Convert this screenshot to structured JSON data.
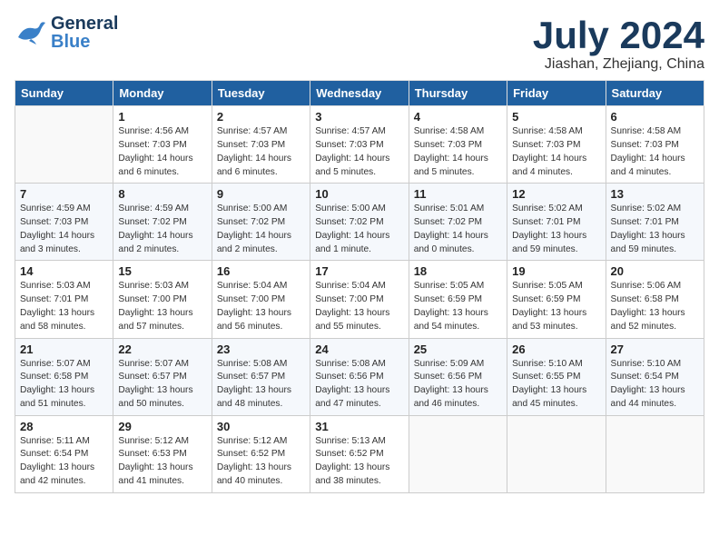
{
  "header": {
    "logo_general": "General",
    "logo_blue": "Blue",
    "month_title": "July 2024",
    "location": "Jiashan, Zhejiang, China"
  },
  "columns": [
    "Sunday",
    "Monday",
    "Tuesday",
    "Wednesday",
    "Thursday",
    "Friday",
    "Saturday"
  ],
  "weeks": [
    [
      {
        "day": "",
        "info": ""
      },
      {
        "day": "1",
        "info": "Sunrise: 4:56 AM\nSunset: 7:03 PM\nDaylight: 14 hours\nand 6 minutes."
      },
      {
        "day": "2",
        "info": "Sunrise: 4:57 AM\nSunset: 7:03 PM\nDaylight: 14 hours\nand 6 minutes."
      },
      {
        "day": "3",
        "info": "Sunrise: 4:57 AM\nSunset: 7:03 PM\nDaylight: 14 hours\nand 5 minutes."
      },
      {
        "day": "4",
        "info": "Sunrise: 4:58 AM\nSunset: 7:03 PM\nDaylight: 14 hours\nand 5 minutes."
      },
      {
        "day": "5",
        "info": "Sunrise: 4:58 AM\nSunset: 7:03 PM\nDaylight: 14 hours\nand 4 minutes."
      },
      {
        "day": "6",
        "info": "Sunrise: 4:58 AM\nSunset: 7:03 PM\nDaylight: 14 hours\nand 4 minutes."
      }
    ],
    [
      {
        "day": "7",
        "info": "Sunrise: 4:59 AM\nSunset: 7:03 PM\nDaylight: 14 hours\nand 3 minutes."
      },
      {
        "day": "8",
        "info": "Sunrise: 4:59 AM\nSunset: 7:02 PM\nDaylight: 14 hours\nand 2 minutes."
      },
      {
        "day": "9",
        "info": "Sunrise: 5:00 AM\nSunset: 7:02 PM\nDaylight: 14 hours\nand 2 minutes."
      },
      {
        "day": "10",
        "info": "Sunrise: 5:00 AM\nSunset: 7:02 PM\nDaylight: 14 hours\nand 1 minute."
      },
      {
        "day": "11",
        "info": "Sunrise: 5:01 AM\nSunset: 7:02 PM\nDaylight: 14 hours\nand 0 minutes."
      },
      {
        "day": "12",
        "info": "Sunrise: 5:02 AM\nSunset: 7:01 PM\nDaylight: 13 hours\nand 59 minutes."
      },
      {
        "day": "13",
        "info": "Sunrise: 5:02 AM\nSunset: 7:01 PM\nDaylight: 13 hours\nand 59 minutes."
      }
    ],
    [
      {
        "day": "14",
        "info": "Sunrise: 5:03 AM\nSunset: 7:01 PM\nDaylight: 13 hours\nand 58 minutes."
      },
      {
        "day": "15",
        "info": "Sunrise: 5:03 AM\nSunset: 7:00 PM\nDaylight: 13 hours\nand 57 minutes."
      },
      {
        "day": "16",
        "info": "Sunrise: 5:04 AM\nSunset: 7:00 PM\nDaylight: 13 hours\nand 56 minutes."
      },
      {
        "day": "17",
        "info": "Sunrise: 5:04 AM\nSunset: 7:00 PM\nDaylight: 13 hours\nand 55 minutes."
      },
      {
        "day": "18",
        "info": "Sunrise: 5:05 AM\nSunset: 6:59 PM\nDaylight: 13 hours\nand 54 minutes."
      },
      {
        "day": "19",
        "info": "Sunrise: 5:05 AM\nSunset: 6:59 PM\nDaylight: 13 hours\nand 53 minutes."
      },
      {
        "day": "20",
        "info": "Sunrise: 5:06 AM\nSunset: 6:58 PM\nDaylight: 13 hours\nand 52 minutes."
      }
    ],
    [
      {
        "day": "21",
        "info": "Sunrise: 5:07 AM\nSunset: 6:58 PM\nDaylight: 13 hours\nand 51 minutes."
      },
      {
        "day": "22",
        "info": "Sunrise: 5:07 AM\nSunset: 6:57 PM\nDaylight: 13 hours\nand 50 minutes."
      },
      {
        "day": "23",
        "info": "Sunrise: 5:08 AM\nSunset: 6:57 PM\nDaylight: 13 hours\nand 48 minutes."
      },
      {
        "day": "24",
        "info": "Sunrise: 5:08 AM\nSunset: 6:56 PM\nDaylight: 13 hours\nand 47 minutes."
      },
      {
        "day": "25",
        "info": "Sunrise: 5:09 AM\nSunset: 6:56 PM\nDaylight: 13 hours\nand 46 minutes."
      },
      {
        "day": "26",
        "info": "Sunrise: 5:10 AM\nSunset: 6:55 PM\nDaylight: 13 hours\nand 45 minutes."
      },
      {
        "day": "27",
        "info": "Sunrise: 5:10 AM\nSunset: 6:54 PM\nDaylight: 13 hours\nand 44 minutes."
      }
    ],
    [
      {
        "day": "28",
        "info": "Sunrise: 5:11 AM\nSunset: 6:54 PM\nDaylight: 13 hours\nand 42 minutes."
      },
      {
        "day": "29",
        "info": "Sunrise: 5:12 AM\nSunset: 6:53 PM\nDaylight: 13 hours\nand 41 minutes."
      },
      {
        "day": "30",
        "info": "Sunrise: 5:12 AM\nSunset: 6:52 PM\nDaylight: 13 hours\nand 40 minutes."
      },
      {
        "day": "31",
        "info": "Sunrise: 5:13 AM\nSunset: 6:52 PM\nDaylight: 13 hours\nand 38 minutes."
      },
      {
        "day": "",
        "info": ""
      },
      {
        "day": "",
        "info": ""
      },
      {
        "day": "",
        "info": ""
      }
    ]
  ]
}
